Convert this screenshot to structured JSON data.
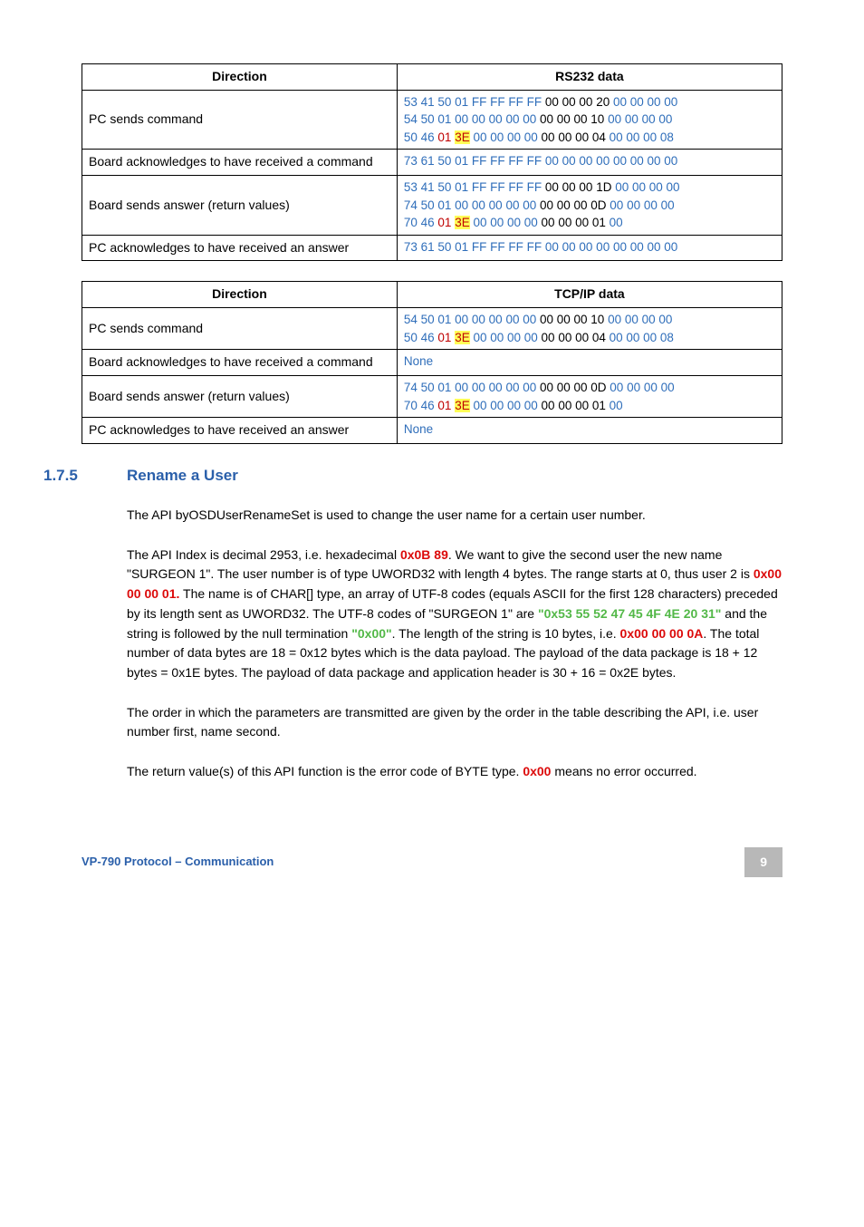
{
  "table1": {
    "headers": [
      "Direction",
      "RS232 data"
    ],
    "rows": [
      {
        "c0": "PC sends command",
        "c1": [
          "<span class='hex'>53 41 50 01 FF FF FF FF</span> 00 00 00 20 <span class='hex'>00 00 00 00</span>",
          "<span class='hex'>54 50 01 00 00 00 00 00</span> 00 00 00 10 <span class='hex'>00 00 00 00</span>",
          "<span class='hex'>50 46 </span><span style='color:#bf0000'>01</span> <span class='highlightY'><span style='color:#bf0000'>3E</span></span> <span class='hex'>00 00 00 00</span> 00 00 00 04 <span class='hex'>00 00 00 08</span>"
        ]
      },
      {
        "c0": "Board acknowledges to have received a command",
        "c1": [
          "<span class='hex'>73 61 50 01 FF FF FF FF 00 00 00 00 00 00 00 00</span>"
        ]
      },
      {
        "c0": "Board sends answer (return values)",
        "c1": [
          "<span class='hex'>53 41 50 01 FF FF FF FF</span> 00 00 00 1D <span class='hex'>00 00 00 00</span>",
          "<span class='hex'>74 50 01 00 00 00 00 00</span> 00 00 00 0D <span class='hex'>00 00 00 00</span>",
          "<span class='hex'>70 46 </span><span style='color:#bf0000'>01</span> <span class='highlightY'><span style='color:#bf0000'>3E</span></span> <span class='hex'>00 00 00 00</span> 00 00 00 01 <span class='hex'>00</span>"
        ]
      },
      {
        "c0": "PC acknowledges to have received an answer",
        "c1": [
          "<span class='hex'>73 61 50 01 FF FF FF FF 00 00 00 00 00 00 00 00</span>"
        ]
      }
    ]
  },
  "table2": {
    "headers": [
      "Direction",
      "TCP/IP data"
    ],
    "rows": [
      {
        "c0": "PC sends command",
        "c1": [
          "<span class='hex'>54 50 01 00 00 00 00 00</span> 00 00 00 10 <span class='hex'>00 00 00 00</span>",
          "<span class='hex'>50 46 </span><span style='color:#bf0000'>01</span> <span class='highlightY'><span style='color:#bf0000'>3E</span></span> <span class='hex'>00 00 00 00</span> 00 00 00 04 <span class='hex'>00 00 00 08</span>"
        ]
      },
      {
        "c0": "Board acknowledges to have received a command",
        "c1": [
          "<span class='hex'>None</span>"
        ]
      },
      {
        "c0": "Board sends answer (return values)",
        "c1": [
          "<span class='hex'>74 50 01 00 00 00 00 00</span> 00 00 00 0D <span class='hex'>00 00 00 00</span>",
          "<span class='hex'>70 46 </span><span style='color:#bf0000'>01</span> <span class='highlightY'><span style='color:#bf0000'>3E</span></span> <span class='hex'>00 00 00 00</span> 00 00 00 01 <span class='hex'>00</span>"
        ]
      },
      {
        "c0": "PC acknowledges to have received an answer",
        "c1": [
          "<span class='hex'>None</span>"
        ]
      }
    ]
  },
  "section": {
    "num": "1.7.5",
    "title": "Rename a User"
  },
  "paragraphs": {
    "p1": "The API byOSDUserRenameSet is used to change the user name for a certain user number.",
    "p2_pre": "The API Index is decimal 2953, i.e. hexadecimal ",
    "p2_idx": "0x0B 89",
    "p2_a": ". We want to give the second user the new name \"SURGEON 1\". The user number is of type UWORD32 with length 4 bytes. The range starts at 0, thus user 2 is ",
    "p2_user": "0x00 00 00 01.",
    "p2_b": " The name is of CHAR[] type, an array of UTF-8 codes (equals ASCII for the first 128 characters) preceded by its length sent as UWORD32. The UTF-8 codes of \"SURGEON 1\" are ",
    "p2_codes": "\"0x53 55 52 47 45 4F 4E 20 31\"",
    "p2_c": " and the string is followed by the null termination ",
    "p2_null": "\"0x00\"",
    "p2_d": ". The length of the string is 10 bytes, i.e. ",
    "p2_len": "0x00 00 00 0A",
    "p2_e": ". The total number of data bytes are 18 = 0x12 bytes which is the data payload. The payload of the data package is 18 + 12 bytes = 0x1E bytes. The payload of data package and application header is 30 + 16 = 0x2E bytes.",
    "p3": "The order in which the parameters are transmitted are given by the order in the table describing the API, i.e. user number first, name second.",
    "p4_a": "The return value(s) of this API function is the error code of BYTE type. ",
    "p4_code": "0x00",
    "p4_b": " means no error occurred."
  },
  "footer": {
    "left": "VP-790 Protocol –  Communication",
    "right": "9"
  }
}
